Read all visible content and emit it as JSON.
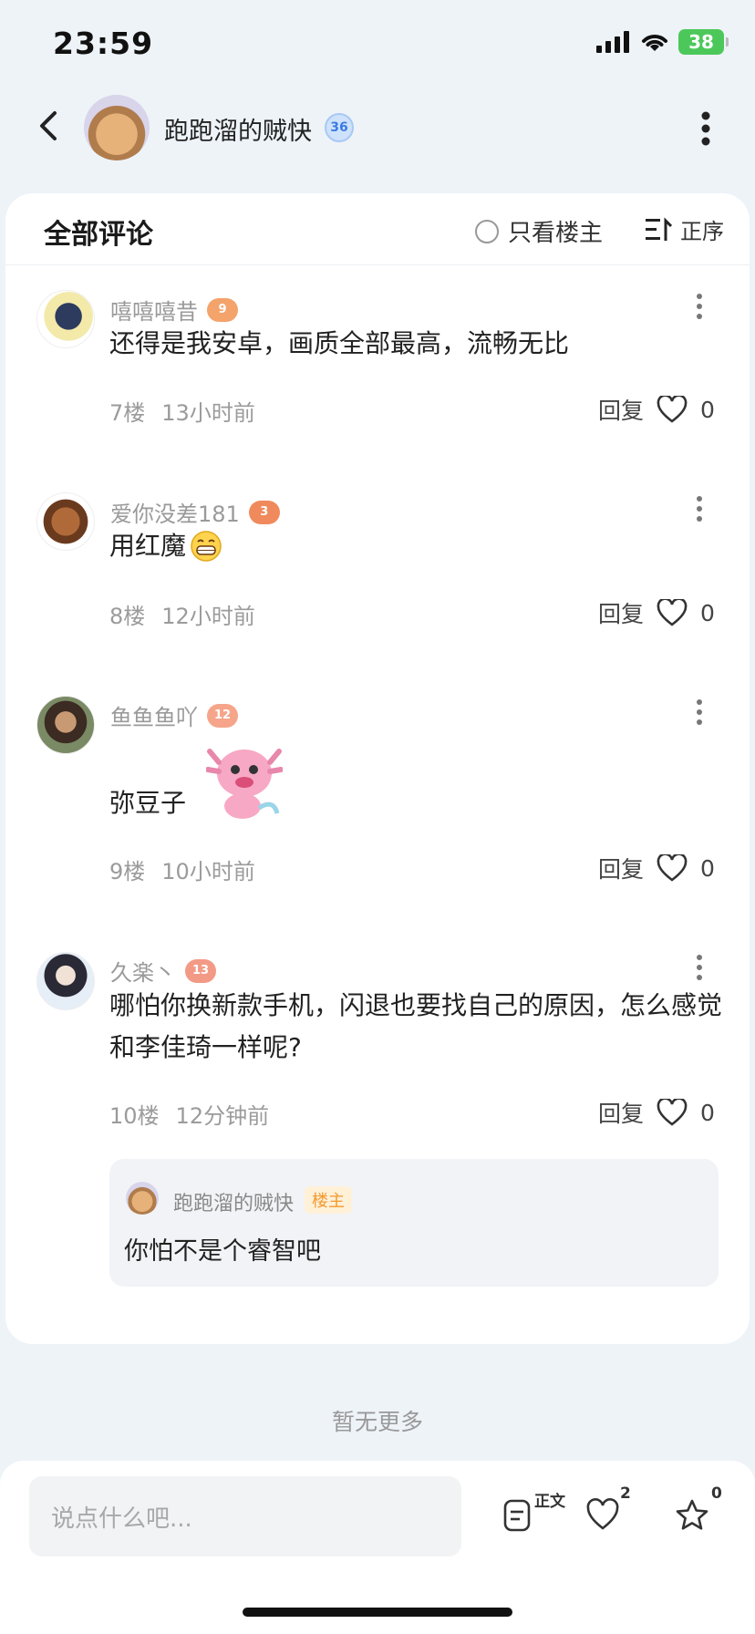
{
  "status": {
    "time": "23:59",
    "battery": "38"
  },
  "header": {
    "name": "跑跑溜的贼快",
    "level": "36"
  },
  "section": {
    "title": "全部评论",
    "owner_only": "只看楼主",
    "sort": "正序"
  },
  "comments": [
    {
      "name": "嘻嘻嘻昔",
      "level": "9",
      "level_color": "#f4a36b",
      "text": "还得是我安卓，画质全部最高，流畅无比",
      "floor": "7楼",
      "time": "13小时前",
      "reply": "回复",
      "likes": "0"
    },
    {
      "name": "爱你没差181",
      "level": "3",
      "level_color": "#f08a5d",
      "text": "用红魔",
      "floor": "8楼",
      "time": "12小时前",
      "reply": "回复",
      "likes": "0"
    },
    {
      "name": "鱼鱼鱼吖",
      "level": "12",
      "level_color": "#f6a58a",
      "text": "弥豆子",
      "floor": "9楼",
      "time": "10小时前",
      "reply": "回复",
      "likes": "0"
    },
    {
      "name": "久楽丶",
      "level": "13",
      "level_color": "#f39a86",
      "text": "哪怕你换新款手机，闪退也要找自己的原因，怎么感觉和李佳琦一样呢?",
      "floor": "10楼",
      "time": "12分钟前",
      "reply": "回复",
      "likes": "0"
    }
  ],
  "nested_reply": {
    "name": "跑跑溜的贼快",
    "tag": "楼主",
    "text": "你怕不是个睿智吧"
  },
  "footer": {
    "no_more": "暂无更多"
  },
  "bottom": {
    "placeholder": "说点什么吧...",
    "doc_label": "正文",
    "likes": "2",
    "stars": "0"
  }
}
